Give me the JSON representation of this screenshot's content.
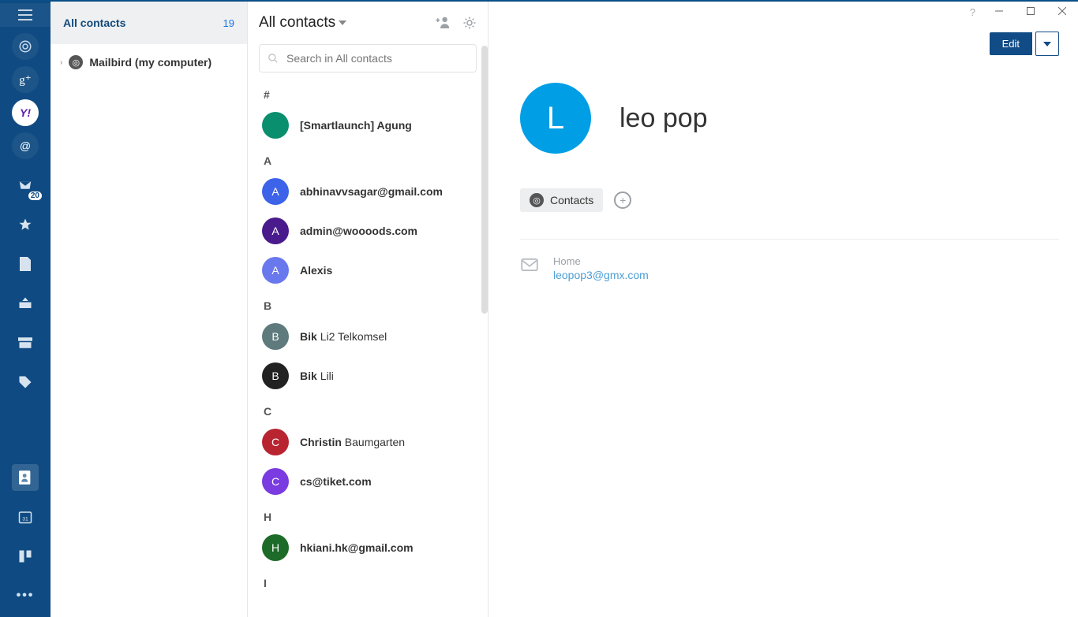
{
  "sidebar": {
    "inbox_badge": "20"
  },
  "accounts": {
    "header_label": "All contacts",
    "count": "19",
    "tree_item": "Mailbird (my computer)"
  },
  "contacts": {
    "title": "All contacts",
    "search_placeholder": "Search in All contacts",
    "sections": {
      "hash": "#",
      "a": "A",
      "b": "B",
      "c": "C",
      "h": "H",
      "i": "I"
    },
    "items": {
      "agung_full": "[Smartlaunch] Agung",
      "abhinav": "abhinavvsagar@gmail.com",
      "admin": "admin@woooods.com",
      "alexis": "Alexis",
      "bik1_b": "Bik ",
      "bik1_r": "Li2 Telkomsel",
      "bik2_b": "Bik ",
      "bik2_r": "Lili",
      "christin_b": "Christin ",
      "christin_r": "Baumgarten",
      "cs": "cs@tiket.com",
      "hkiani": "hkiani.hk@gmail.com"
    }
  },
  "detail": {
    "edit_label": "Edit",
    "avatar_letter": "L",
    "name": "leo pop",
    "chip_label": "Contacts",
    "email_label": "Home",
    "email_value": "leopop3@gmx.com"
  }
}
